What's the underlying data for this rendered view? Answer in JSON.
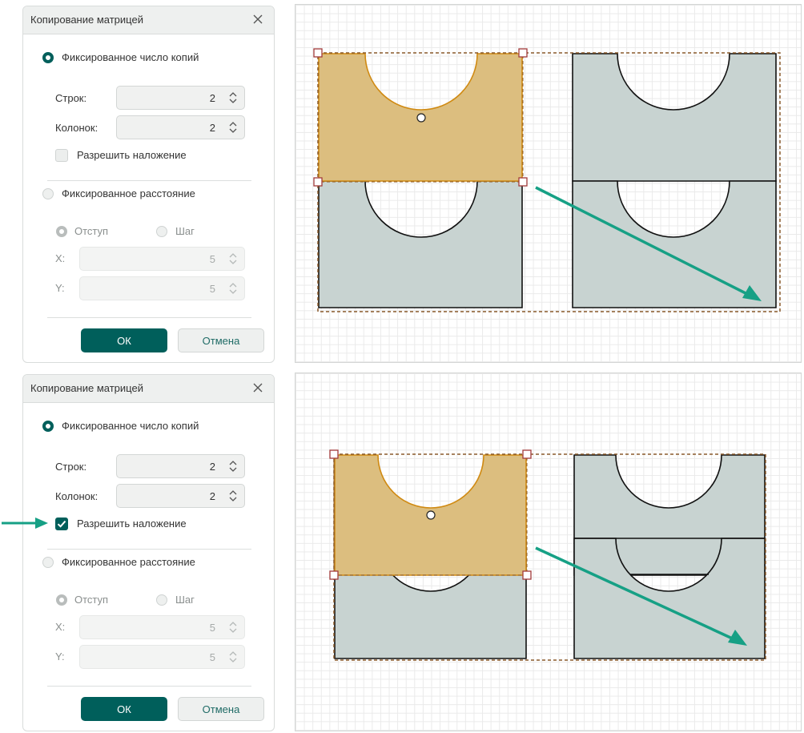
{
  "colors": {
    "accent": "#005f5b",
    "selected_fill": "#dcbe7f",
    "part_fill": "#c8d3d1",
    "guide_arrow": "#16a085",
    "marquee": "#8a5a2b"
  },
  "icons": {
    "close": "close-icon",
    "spinner": "spinner-arrows-icon",
    "check": "check-icon",
    "pointer_arrow": "arrow-right-icon"
  },
  "panels": [
    {
      "dialog": {
        "title": "Копирование матрицей",
        "mode_fixed_count": {
          "label": "Фиксированное число копий",
          "selected": true
        },
        "rows": {
          "label": "Строк:",
          "value": "2"
        },
        "cols": {
          "label": "Колонок:",
          "value": "2"
        },
        "overlap": {
          "label": "Разрешить наложение",
          "checked": false
        },
        "mode_fixed_distance": {
          "label": "Фиксированное расстояние",
          "selected": false
        },
        "offset_option": {
          "label": "Отступ",
          "selected": true
        },
        "step_option": {
          "label": "Шаг",
          "selected": false
        },
        "x": {
          "label": "X:",
          "value": "5"
        },
        "y": {
          "label": "Y:",
          "value": "5"
        },
        "ok": "ОК",
        "cancel": "Отмена"
      },
      "canvas": {
        "overlap_enabled": false
      }
    },
    {
      "dialog": {
        "title": "Копирование матрицей",
        "mode_fixed_count": {
          "label": "Фиксированное число копий",
          "selected": true
        },
        "rows": {
          "label": "Строк:",
          "value": "2"
        },
        "cols": {
          "label": "Колонок:",
          "value": "2"
        },
        "overlap": {
          "label": "Разрешить наложение",
          "checked": true
        },
        "mode_fixed_distance": {
          "label": "Фиксированное расстояние",
          "selected": false
        },
        "offset_option": {
          "label": "Отступ",
          "selected": true
        },
        "step_option": {
          "label": "Шаг",
          "selected": false
        },
        "x": {
          "label": "X:",
          "value": "5"
        },
        "y": {
          "label": "Y:",
          "value": "5"
        },
        "ok": "ОК",
        "cancel": "Отмена"
      },
      "canvas": {
        "overlap_enabled": true
      }
    }
  ]
}
